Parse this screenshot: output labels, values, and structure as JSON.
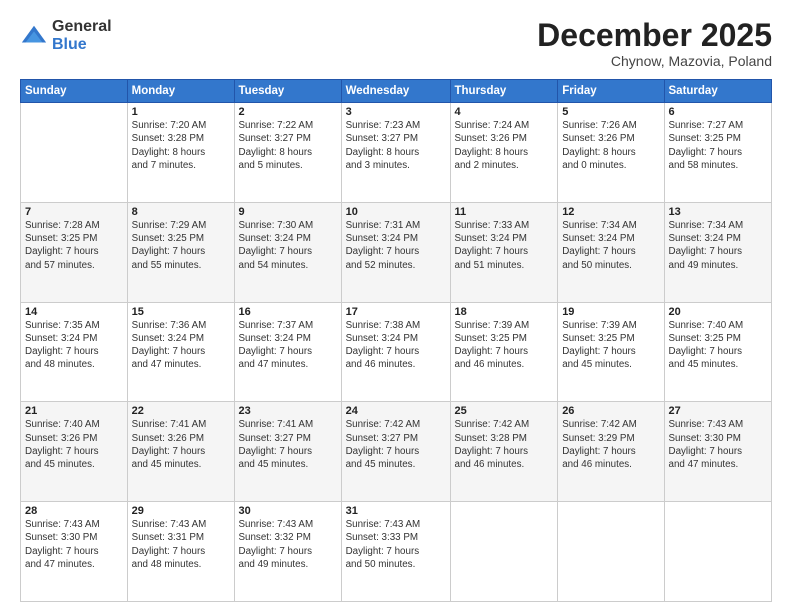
{
  "header": {
    "logo": {
      "general": "General",
      "blue": "Blue"
    },
    "title": "December 2025",
    "location": "Chynow, Mazovia, Poland"
  },
  "calendar": {
    "days_of_week": [
      "Sunday",
      "Monday",
      "Tuesday",
      "Wednesday",
      "Thursday",
      "Friday",
      "Saturday"
    ],
    "weeks": [
      [
        {
          "day": null,
          "info": null
        },
        {
          "day": "1",
          "info": "Sunrise: 7:20 AM\nSunset: 3:28 PM\nDaylight: 8 hours\nand 7 minutes."
        },
        {
          "day": "2",
          "info": "Sunrise: 7:22 AM\nSunset: 3:27 PM\nDaylight: 8 hours\nand 5 minutes."
        },
        {
          "day": "3",
          "info": "Sunrise: 7:23 AM\nSunset: 3:27 PM\nDaylight: 8 hours\nand 3 minutes."
        },
        {
          "day": "4",
          "info": "Sunrise: 7:24 AM\nSunset: 3:26 PM\nDaylight: 8 hours\nand 2 minutes."
        },
        {
          "day": "5",
          "info": "Sunrise: 7:26 AM\nSunset: 3:26 PM\nDaylight: 8 hours\nand 0 minutes."
        },
        {
          "day": "6",
          "info": "Sunrise: 7:27 AM\nSunset: 3:25 PM\nDaylight: 7 hours\nand 58 minutes."
        }
      ],
      [
        {
          "day": "7",
          "info": "Sunrise: 7:28 AM\nSunset: 3:25 PM\nDaylight: 7 hours\nand 57 minutes."
        },
        {
          "day": "8",
          "info": "Sunrise: 7:29 AM\nSunset: 3:25 PM\nDaylight: 7 hours\nand 55 minutes."
        },
        {
          "day": "9",
          "info": "Sunrise: 7:30 AM\nSunset: 3:24 PM\nDaylight: 7 hours\nand 54 minutes."
        },
        {
          "day": "10",
          "info": "Sunrise: 7:31 AM\nSunset: 3:24 PM\nDaylight: 7 hours\nand 52 minutes."
        },
        {
          "day": "11",
          "info": "Sunrise: 7:33 AM\nSunset: 3:24 PM\nDaylight: 7 hours\nand 51 minutes."
        },
        {
          "day": "12",
          "info": "Sunrise: 7:34 AM\nSunset: 3:24 PM\nDaylight: 7 hours\nand 50 minutes."
        },
        {
          "day": "13",
          "info": "Sunrise: 7:34 AM\nSunset: 3:24 PM\nDaylight: 7 hours\nand 49 minutes."
        }
      ],
      [
        {
          "day": "14",
          "info": "Sunrise: 7:35 AM\nSunset: 3:24 PM\nDaylight: 7 hours\nand 48 minutes."
        },
        {
          "day": "15",
          "info": "Sunrise: 7:36 AM\nSunset: 3:24 PM\nDaylight: 7 hours\nand 47 minutes."
        },
        {
          "day": "16",
          "info": "Sunrise: 7:37 AM\nSunset: 3:24 PM\nDaylight: 7 hours\nand 47 minutes."
        },
        {
          "day": "17",
          "info": "Sunrise: 7:38 AM\nSunset: 3:24 PM\nDaylight: 7 hours\nand 46 minutes."
        },
        {
          "day": "18",
          "info": "Sunrise: 7:39 AM\nSunset: 3:25 PM\nDaylight: 7 hours\nand 46 minutes."
        },
        {
          "day": "19",
          "info": "Sunrise: 7:39 AM\nSunset: 3:25 PM\nDaylight: 7 hours\nand 45 minutes."
        },
        {
          "day": "20",
          "info": "Sunrise: 7:40 AM\nSunset: 3:25 PM\nDaylight: 7 hours\nand 45 minutes."
        }
      ],
      [
        {
          "day": "21",
          "info": "Sunrise: 7:40 AM\nSunset: 3:26 PM\nDaylight: 7 hours\nand 45 minutes."
        },
        {
          "day": "22",
          "info": "Sunrise: 7:41 AM\nSunset: 3:26 PM\nDaylight: 7 hours\nand 45 minutes."
        },
        {
          "day": "23",
          "info": "Sunrise: 7:41 AM\nSunset: 3:27 PM\nDaylight: 7 hours\nand 45 minutes."
        },
        {
          "day": "24",
          "info": "Sunrise: 7:42 AM\nSunset: 3:27 PM\nDaylight: 7 hours\nand 45 minutes."
        },
        {
          "day": "25",
          "info": "Sunrise: 7:42 AM\nSunset: 3:28 PM\nDaylight: 7 hours\nand 46 minutes."
        },
        {
          "day": "26",
          "info": "Sunrise: 7:42 AM\nSunset: 3:29 PM\nDaylight: 7 hours\nand 46 minutes."
        },
        {
          "day": "27",
          "info": "Sunrise: 7:43 AM\nSunset: 3:30 PM\nDaylight: 7 hours\nand 47 minutes."
        }
      ],
      [
        {
          "day": "28",
          "info": "Sunrise: 7:43 AM\nSunset: 3:30 PM\nDaylight: 7 hours\nand 47 minutes."
        },
        {
          "day": "29",
          "info": "Sunrise: 7:43 AM\nSunset: 3:31 PM\nDaylight: 7 hours\nand 48 minutes."
        },
        {
          "day": "30",
          "info": "Sunrise: 7:43 AM\nSunset: 3:32 PM\nDaylight: 7 hours\nand 49 minutes."
        },
        {
          "day": "31",
          "info": "Sunrise: 7:43 AM\nSunset: 3:33 PM\nDaylight: 7 hours\nand 50 minutes."
        },
        {
          "day": null,
          "info": null
        },
        {
          "day": null,
          "info": null
        },
        {
          "day": null,
          "info": null
        }
      ]
    ]
  }
}
